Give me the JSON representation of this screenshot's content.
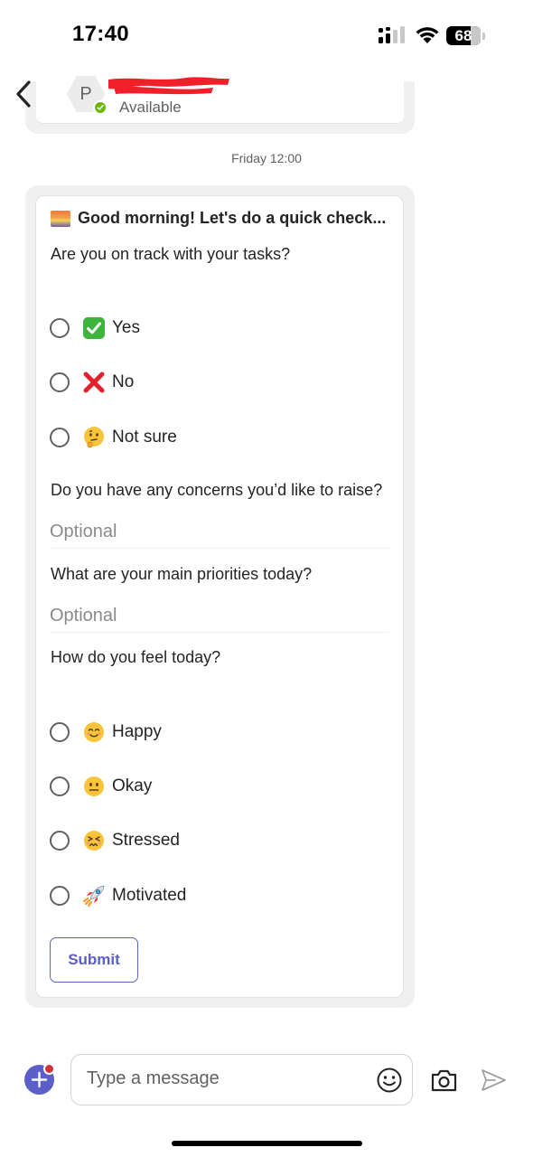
{
  "status_bar": {
    "time": "17:40",
    "battery": "68"
  },
  "header": {
    "avatar_initial": "P",
    "presence": "Available"
  },
  "timestamp": "Friday 12:00",
  "card": {
    "title": "Good morning! Let's do a quick check...",
    "q1": {
      "question": "Are you on track with your tasks?",
      "options": [
        "Yes",
        "No",
        "Not sure"
      ]
    },
    "q2": {
      "question": "Do you have any concerns you’d like to raise?",
      "placeholder": "Optional"
    },
    "q3": {
      "question": "What are your main priorities today?",
      "placeholder": "Optional"
    },
    "q4": {
      "question": "How do you feel today?",
      "options": [
        "Happy",
        "Okay",
        "Stressed",
        "Motivated"
      ]
    },
    "submit_label": "Submit"
  },
  "compose": {
    "placeholder": "Type a message"
  },
  "icons": {
    "title": "sunrise-icon",
    "q1": [
      "check-mark-button-icon",
      "cross-mark-icon",
      "thinking-face-icon"
    ],
    "q4": [
      "smiling-face-icon",
      "neutral-face-icon",
      "persevering-face-icon",
      "rocket-icon"
    ]
  },
  "colors": {
    "accent": "#5b5fc7",
    "presence": "#6bb700",
    "notification": "#d13438"
  }
}
